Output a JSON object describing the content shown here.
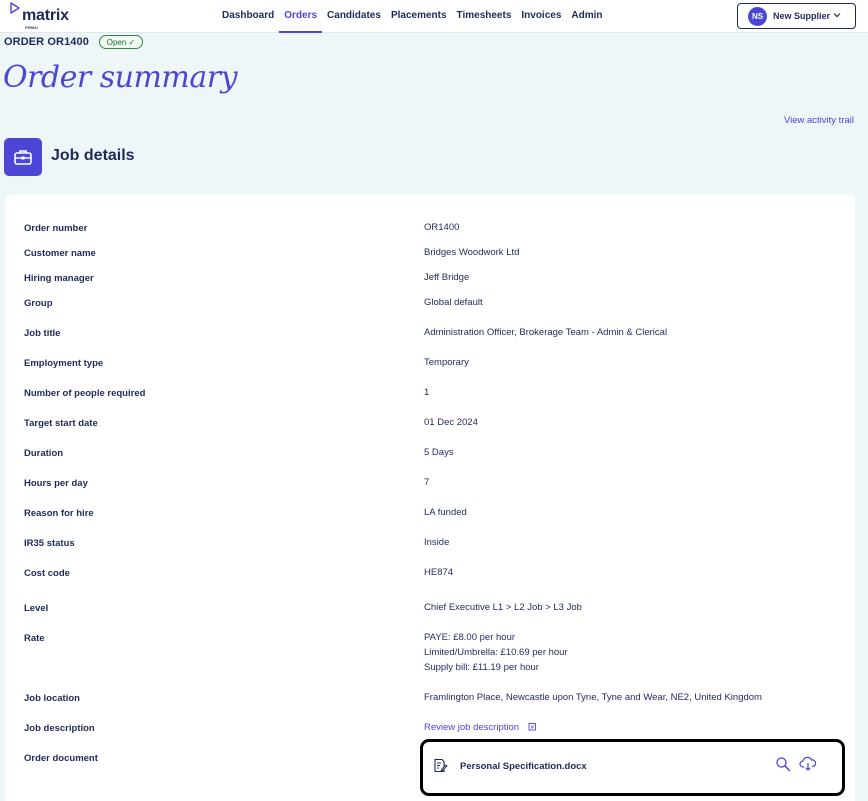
{
  "app": {
    "logo_text": "matrix",
    "logo_sub": "PRMU",
    "accent_color": "#4b46d6"
  },
  "nav": {
    "items": [
      {
        "label": "Dashboard",
        "active": false
      },
      {
        "label": "Orders",
        "active": true
      },
      {
        "label": "Candidates",
        "active": false
      },
      {
        "label": "Placements",
        "active": false
      },
      {
        "label": "Timesheets",
        "active": false
      },
      {
        "label": "Invoices",
        "active": false
      },
      {
        "label": "Admin",
        "active": false
      }
    ]
  },
  "user": {
    "initials": "NS",
    "name": "New Supplier"
  },
  "order": {
    "id_label": "ORDER OR1400",
    "status": "Open ✓"
  },
  "page": {
    "title": "Order summary",
    "activity_link": "View activity trail"
  },
  "section": {
    "title": "Job details",
    "icon": "briefcase-icon"
  },
  "details": {
    "order_number": {
      "label": "Order number",
      "value": "OR1400"
    },
    "customer_name": {
      "label": "Customer name",
      "value": "Bridges Woodwork Ltd"
    },
    "hiring_manager": {
      "label": "Hiring manager",
      "value": "Jeff Bridge"
    },
    "group": {
      "label": "Group",
      "value": "Global default"
    },
    "job_title": {
      "label": "Job title",
      "value": "Administration Officer, Brokerage Team - Admin & Clerical"
    },
    "employment_type": {
      "label": "Employment type",
      "value": "Temporary"
    },
    "people_required": {
      "label": "Number of people required",
      "value": "1"
    },
    "target_start_date": {
      "label": "Target start date",
      "value": "01 Dec 2024"
    },
    "duration": {
      "label": "Duration",
      "value": "5 Days"
    },
    "hours_per_day": {
      "label": "Hours per day",
      "value": "7"
    },
    "reason_for_hire": {
      "label": "Reason for hire",
      "value": "LA funded"
    },
    "ir35_status": {
      "label": "IR35 status",
      "value": "Inside"
    },
    "cost_code": {
      "label": "Cost code",
      "value": "HE874"
    },
    "level": {
      "label": "Level",
      "value": "Chief Executive L1 > L2 Job > L3 Job"
    },
    "rate": {
      "label": "Rate",
      "paye": "PAYE: £8.00 per hour",
      "limited": "Limited/Umbrella: £10.69 per hour",
      "supply": "Supply bill: £11.19 per hour"
    },
    "job_location": {
      "label": "Job location",
      "value": "Framlington Place, Newcastle upon Tyne, Tyne and Wear, NE2, United Kingdom"
    },
    "job_description": {
      "label": "Job description",
      "value": "Review job description"
    },
    "order_document": {
      "label": "Order document",
      "file_name": "Personal Specification.docx"
    }
  }
}
